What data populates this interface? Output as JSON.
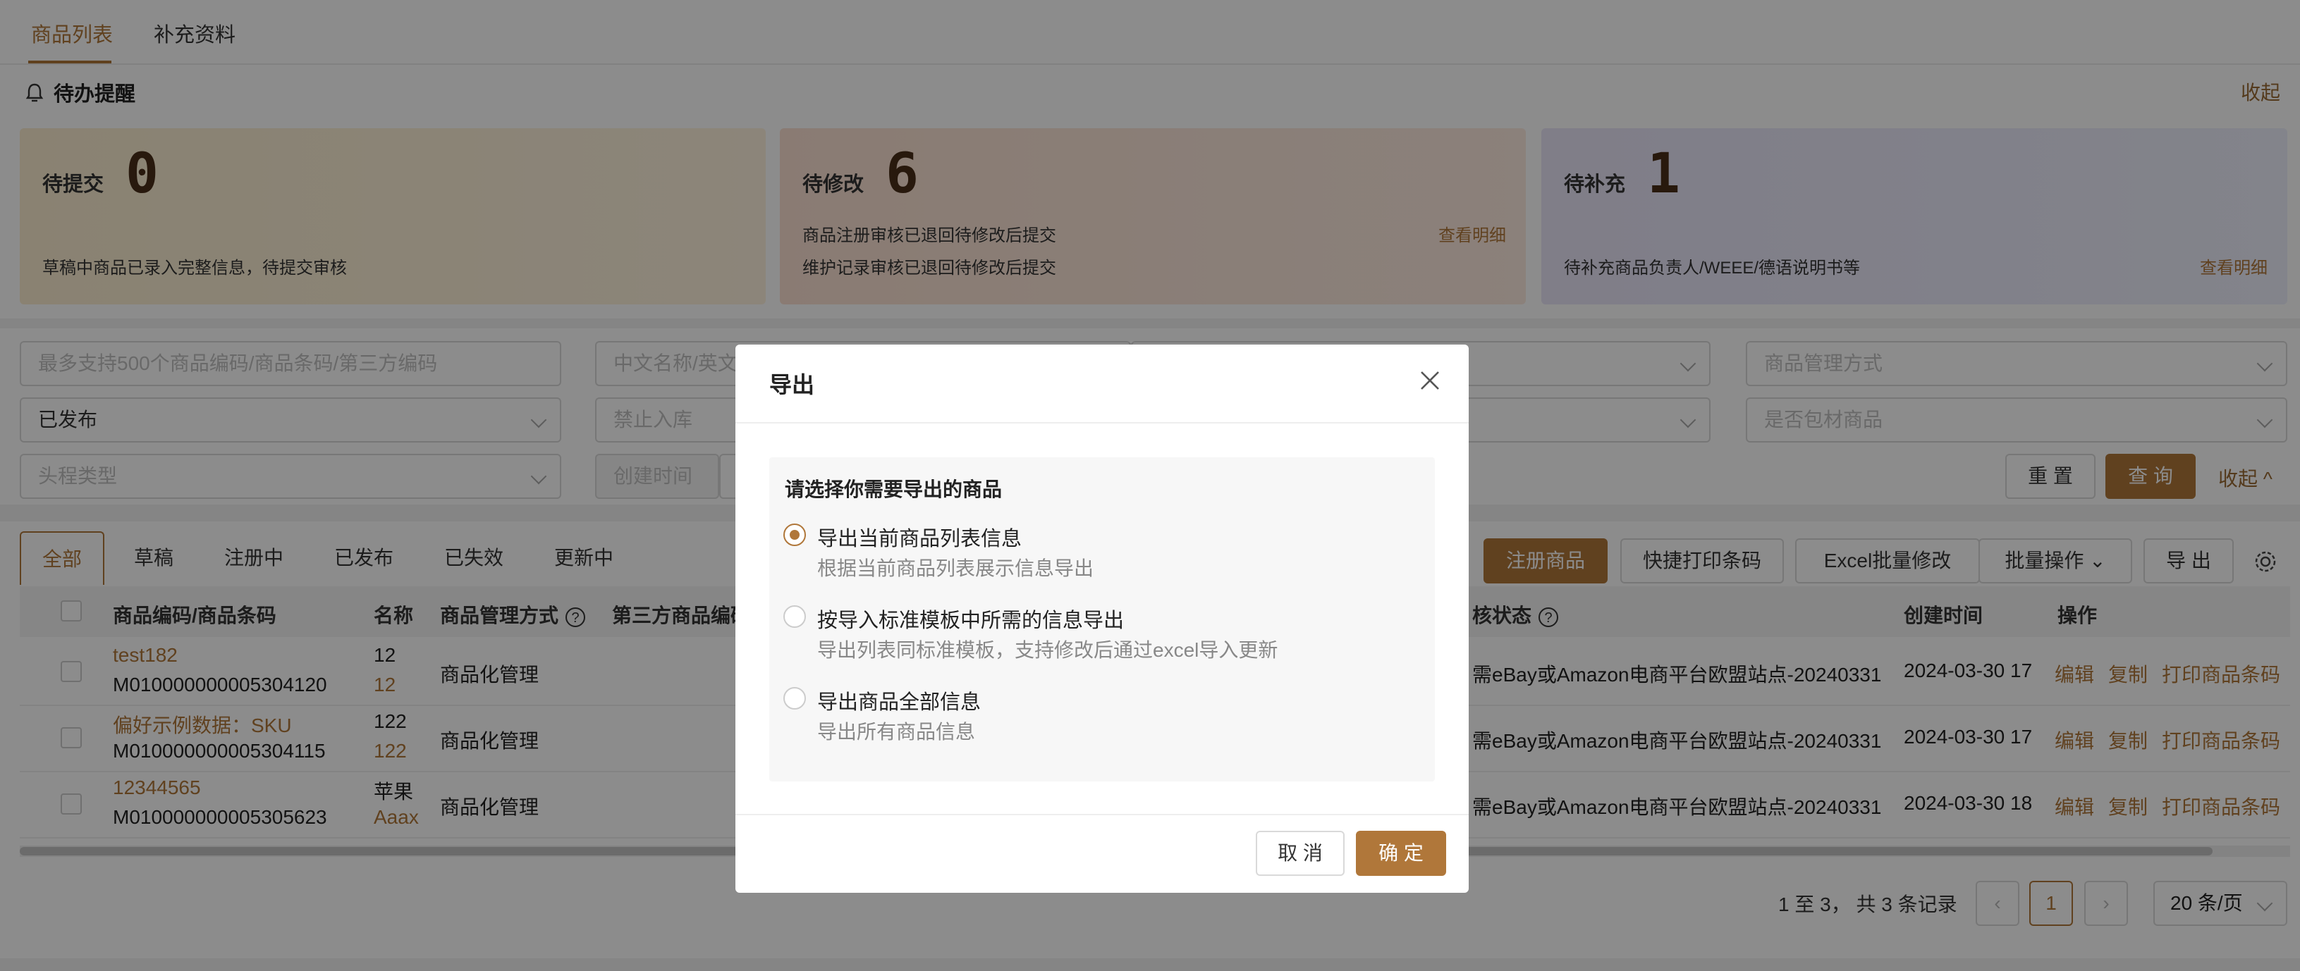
{
  "top_tabs": [
    "商品列表",
    "补充资料"
  ],
  "todo": {
    "title": "待办提醒",
    "collapse_label": "收起",
    "cards": [
      {
        "label": "待提交",
        "count": "0",
        "desc1": "草稿中商品已录入完整信息，待提交审核",
        "desc2": "",
        "link": ""
      },
      {
        "label": "待修改",
        "count": "6",
        "desc1": "商品注册审核已退回待修改后提交",
        "desc2": "维护记录审核已退回待修改后提交",
        "link": "查看明细"
      },
      {
        "label": "待补充",
        "count": "1",
        "desc1": "待补充商品负责人/WEEE/德语说明书等",
        "desc2": "",
        "link": "查看明细"
      }
    ]
  },
  "filters": {
    "code_placeholder": "最多支持500个商品编码/商品条码/第三方编码",
    "name_placeholder": "中文名称/英文",
    "mgmt_placeholder": "商品管理方式",
    "status_value": "已发布",
    "inbound_placeholder": "禁止入库",
    "package_placeholder": "是否包材商品",
    "head_type_placeholder": "头程类型",
    "created_placeholder": "创建时间",
    "reset": "重 置",
    "query": "查 询",
    "collapse": "收起"
  },
  "status_tabs": [
    "全部",
    "草稿",
    "注册中",
    "已发布",
    "已失效",
    "更新中"
  ],
  "actions": {
    "register": "注册商品",
    "print_barcode": "快捷打印条码",
    "excel_edit": "Excel批量修改",
    "batch_ops": "批量操作",
    "export": "导 出"
  },
  "table": {
    "headers": {
      "code": "商品编码/商品条码",
      "name": "名称",
      "mgmt": "商品管理方式",
      "third": "第三方商品编码",
      "audit": "核状态",
      "created": "创建时间",
      "ops": "操作"
    },
    "rows": [
      {
        "code": "test182",
        "barcode": "M010000000005304120",
        "name1": "12",
        "name2": "12",
        "mgmt": "商品化管理",
        "audit": "需eBay或Amazon电商平台欧盟站点-20240331",
        "created": "2024-03-30 17"
      },
      {
        "code": "偏好示例数据：SKU",
        "barcode": "M010000000005304115",
        "name1": "122",
        "name2": "122",
        "mgmt": "商品化管理",
        "audit": "需eBay或Amazon电商平台欧盟站点-20240331",
        "created": "2024-03-30 17"
      },
      {
        "code": "12344565",
        "barcode": "M010000000005305623",
        "name1": "苹果",
        "name2": "Aaax",
        "mgmt": "商品化管理",
        "audit": "需eBay或Amazon电商平台欧盟站点-20240331",
        "created": "2024-03-30 18"
      }
    ],
    "op_labels": {
      "edit": "编辑",
      "copy": "复制",
      "print": "打印商品条码"
    }
  },
  "pagination": {
    "summary": "1 至 3， 共 3 条记录",
    "current_page": "1",
    "page_size": "20 条/页"
  },
  "modal": {
    "title": "导出",
    "prompt": "请选择你需要导出的商品",
    "options": [
      {
        "label": "导出当前商品列表信息",
        "desc": "根据当前商品列表展示信息导出",
        "selected": true
      },
      {
        "label": "按导入标准模板中所需的信息导出",
        "desc": "导出列表同标准模板，支持修改后通过excel导入更新",
        "selected": false
      },
      {
        "label": "导出商品全部信息",
        "desc": "导出所有商品信息",
        "selected": false
      }
    ],
    "cancel": "取 消",
    "confirm": "确 定"
  },
  "colors": {
    "accent": "#b0773a",
    "overlay": "rgba(0,0,0,0.45)"
  }
}
